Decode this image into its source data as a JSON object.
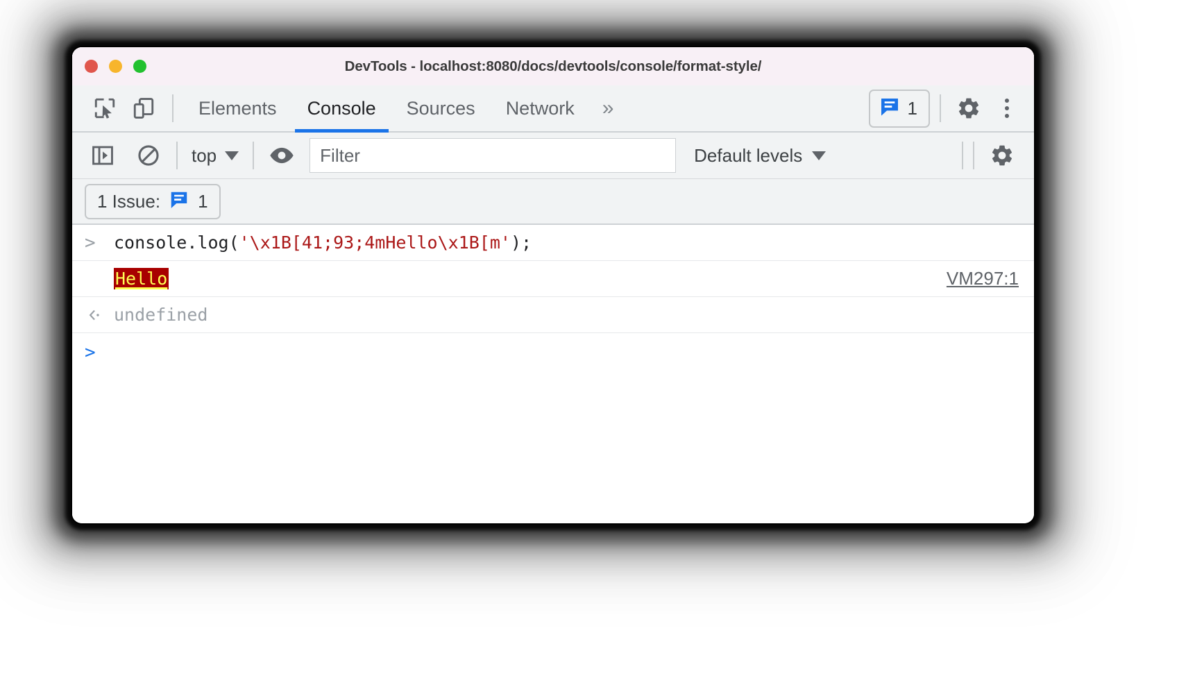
{
  "window": {
    "title": "DevTools - localhost:8080/docs/devtools/console/format-style/",
    "traffic_lights": [
      "close",
      "minimize",
      "maximize"
    ],
    "colors": {
      "titlebar_bg": "#f8f0f6",
      "toolbar_bg": "#f1f3f4",
      "accent_blue": "#1a73e8",
      "close": "#e0564c",
      "minimize": "#f7b52c",
      "maximize": "#22c12f"
    }
  },
  "toolbar": {
    "inspect_icon": "inspect-element-icon",
    "device_icon": "device-toolbar-icon",
    "tabs": [
      {
        "label": "Elements",
        "active": false
      },
      {
        "label": "Console",
        "active": true
      },
      {
        "label": "Sources",
        "active": false
      },
      {
        "label": "Network",
        "active": false
      }
    ],
    "more_tabs_label": "»",
    "issues_badge": {
      "icon": "issue-bubble-icon",
      "count": "1"
    },
    "settings_icon": "gear-icon",
    "menu_icon": "kebab-menu-icon"
  },
  "filterbar": {
    "sidebar_toggle_icon": "console-sidebar-icon",
    "clear_console_icon": "clear-console-icon",
    "context_selector": {
      "value": "top",
      "caret": "chevron-down-icon"
    },
    "eye_icon": "live-expression-icon",
    "filter": {
      "placeholder": "Filter",
      "value": ""
    },
    "levels": {
      "value": "Default levels",
      "caret": "chevron-down-icon"
    },
    "settings_icon": "gear-icon"
  },
  "issues_banner": {
    "label": "1 Issue:",
    "icon": "issue-bubble-icon",
    "count": "1"
  },
  "console": {
    "entries": [
      {
        "type": "input",
        "gutter": ">",
        "code_prefix": "console.log(",
        "code_string": "'\\x1B[41;93;4mHello\\x1B[m'",
        "code_suffix": ");"
      },
      {
        "type": "output",
        "gutter": "",
        "text": "Hello",
        "style": {
          "background": "#a80000",
          "color": "#ffff55",
          "underline": true
        },
        "source": "VM297:1"
      },
      {
        "type": "result",
        "gutter": "‹·",
        "text": "undefined"
      }
    ],
    "prompt": {
      "gutter": ">",
      "value": ""
    }
  }
}
